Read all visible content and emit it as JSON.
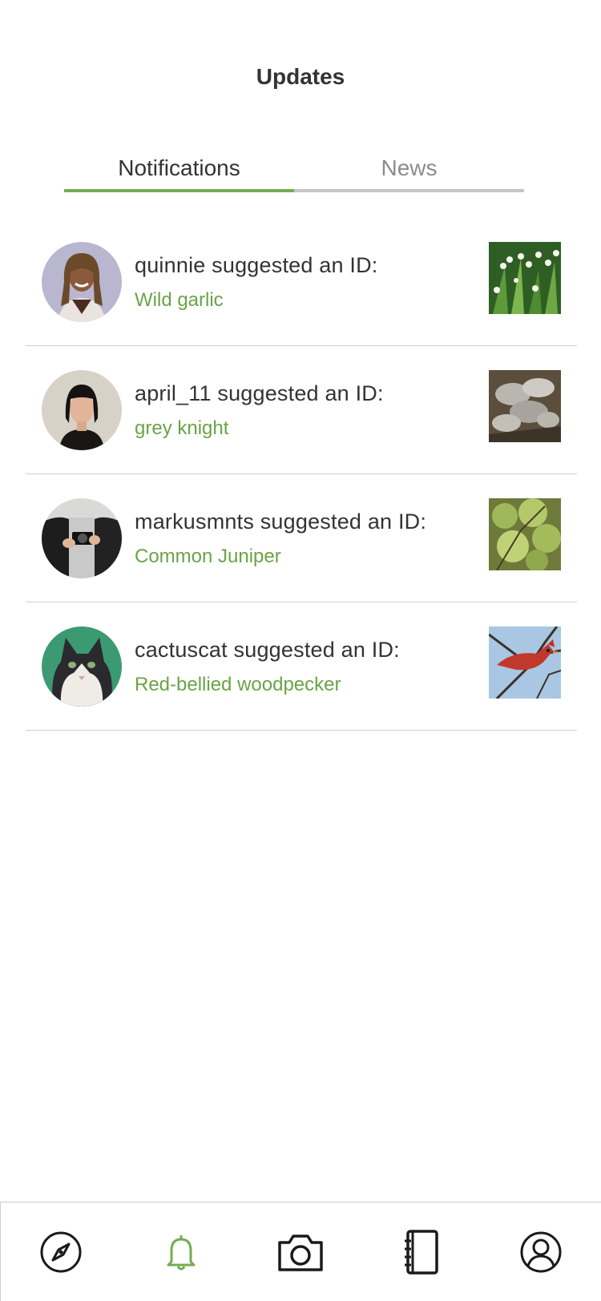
{
  "header": {
    "title": "Updates"
  },
  "tabs": [
    {
      "label": "Notifications",
      "active": true
    },
    {
      "label": "News",
      "active": false
    }
  ],
  "notifications": [
    {
      "title": "quinnie suggested an ID:",
      "species": "Wild garlic",
      "avatar": "person-avatar",
      "thumbnail": "wild-garlic-photo"
    },
    {
      "title": "april_11 suggested an ID:",
      "species": "grey knight",
      "avatar": "person-avatar",
      "thumbnail": "mushroom-photo"
    },
    {
      "title": "markusmnts suggested an ID:",
      "species": "Common Juniper",
      "avatar": "person-with-camera-avatar",
      "thumbnail": "juniper-photo"
    },
    {
      "title": "cactuscat suggested an ID:",
      "species": "Red-bellied woodpecker",
      "avatar": "cat-avatar",
      "thumbnail": "bird-photo"
    }
  ],
  "bottom_nav": [
    {
      "icon": "compass-icon",
      "active": false
    },
    {
      "icon": "bell-icon",
      "active": true
    },
    {
      "icon": "camera-icon",
      "active": false
    },
    {
      "icon": "notebook-icon",
      "active": false
    },
    {
      "icon": "profile-icon",
      "active": false
    }
  ],
  "colors": {
    "accent": "#74ac4f",
    "species_text": "#6aa444",
    "inactive_tab": "#8c8c8c",
    "icon": "#1a1a1a"
  }
}
